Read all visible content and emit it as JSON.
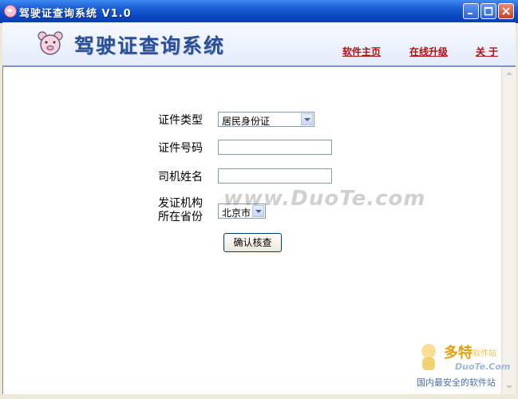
{
  "window": {
    "title": "驾驶证查询系统 V1.0"
  },
  "header": {
    "app_name": "驾驶证查询系统",
    "links": [
      "软件主页",
      "在线升级",
      "关 于"
    ]
  },
  "form": {
    "id_type_label": "证件类型",
    "id_type_value": "居民身份证",
    "id_number_label": "证件号码",
    "id_number_value": "",
    "driver_name_label": "司机姓名",
    "driver_name_value": "",
    "issuer_label_line1": "发证机构",
    "issuer_label_line2": "所在省份",
    "province_value": "北京市",
    "confirm_button": "确认核查"
  },
  "watermark": {
    "text": "www.DuoTe.com"
  },
  "corner_logo": {
    "title": "多特",
    "subtitle": "软件站",
    "site": "DuoTe.Com",
    "slogan": "国内最安全的软件站"
  },
  "colors": {
    "title_bar": "#0b48c2",
    "link": "#b01010",
    "logo_text": "#2b4f96"
  }
}
